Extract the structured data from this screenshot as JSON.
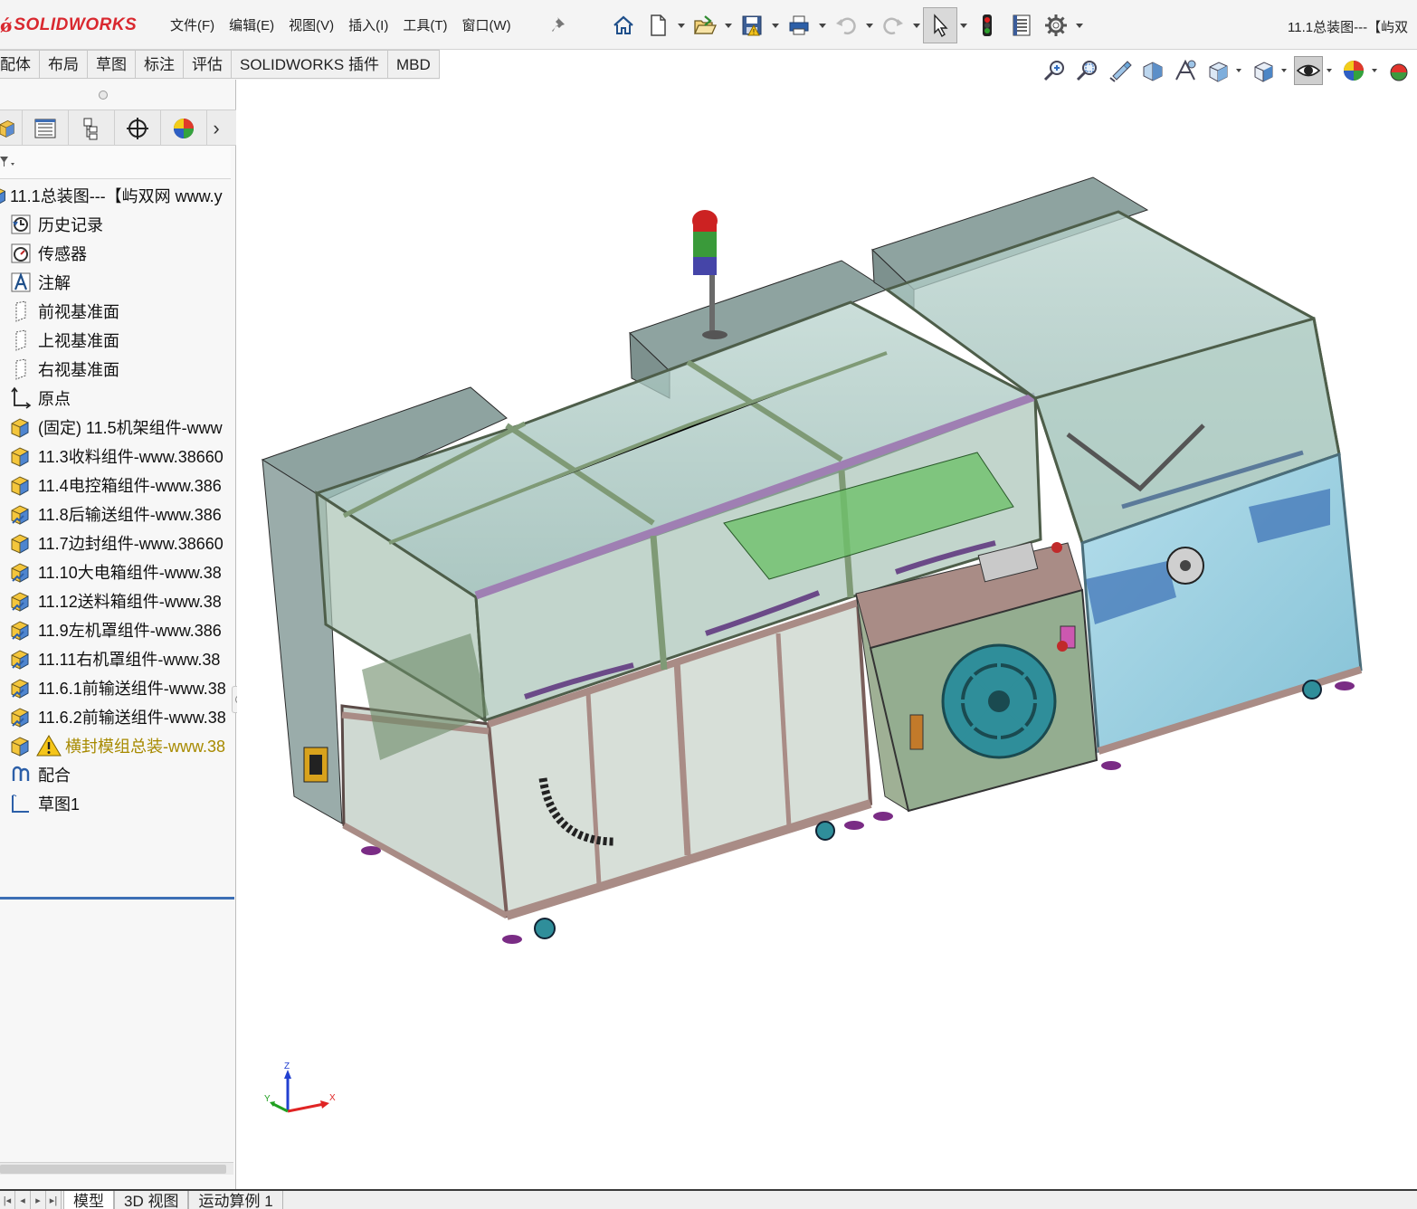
{
  "app": {
    "logo_prefix": "ǿ",
    "logo_text": "SOLIDWORKS"
  },
  "menu": [
    "文件(F)",
    "编辑(E)",
    "视图(V)",
    "插入(I)",
    "工具(T)",
    "窗口(W)"
  ],
  "document_title": "11.1总装图---【屿双",
  "toolbar": [
    {
      "icon": "home-icon"
    },
    {
      "icon": "new-document-icon",
      "dropdown": true
    },
    {
      "icon": "open-icon",
      "dropdown": true
    },
    {
      "icon": "save-icon",
      "dropdown": true
    },
    {
      "icon": "print-icon",
      "dropdown": true
    },
    {
      "icon": "undo-icon",
      "dropdown": true
    },
    {
      "icon": "redo-icon",
      "dropdown": true
    },
    {
      "icon": "select-cursor-icon",
      "dropdown": true,
      "active": true
    },
    {
      "icon": "rebuild-traffic-light-icon"
    },
    {
      "icon": "file-properties-icon"
    },
    {
      "icon": "options-gear-icon",
      "dropdown": true
    }
  ],
  "command_tabs": [
    "配体",
    "布局",
    "草图",
    "标注",
    "评估",
    "SOLIDWORKS 插件",
    "MBD"
  ],
  "hud_icons": [
    "zoom-to-fit-icon",
    "zoom-to-area-icon",
    "previous-view-icon",
    "section-view-icon",
    "dynamic-annotation-icon",
    "view-orientation-icon",
    "display-style-icon",
    "hide-show-items-icon",
    "edit-appearance-icon",
    "apply-scene-icon"
  ],
  "panel_tabs": [
    "featuremanager-tab",
    "propertymanager-tab",
    "configurationmanager-tab",
    "dimxpertmanager-tab",
    "displaymanager-tab"
  ],
  "feature_tree": {
    "root": "11.1总装图---【屿双网 www.y",
    "items": [
      {
        "label": "历史记录",
        "icon": "history-icon"
      },
      {
        "label": "传感器",
        "icon": "sensor-icon"
      },
      {
        "label": "注解",
        "icon": "annotation-icon"
      },
      {
        "label": "前视基准面",
        "icon": "plane-icon"
      },
      {
        "label": "上视基准面",
        "icon": "plane-icon"
      },
      {
        "label": "右视基准面",
        "icon": "plane-icon"
      },
      {
        "label": "原点",
        "icon": "origin-icon"
      },
      {
        "label": "(固定) 11.5机架组件-www",
        "icon": "assembly-icon"
      },
      {
        "label": "11.3收料组件-www.38660",
        "icon": "assembly-icon"
      },
      {
        "label": "11.4电控箱组件-www.386",
        "icon": "assembly-icon"
      },
      {
        "label": "11.8后输送组件-www.386",
        "icon": "assembly-flex-icon"
      },
      {
        "label": "11.7边封组件-www.38660",
        "icon": "assembly-icon"
      },
      {
        "label": "11.10大电箱组件-www.38",
        "icon": "assembly-flex-icon"
      },
      {
        "label": "11.12送料箱组件-www.38",
        "icon": "assembly-flex-icon"
      },
      {
        "label": "11.9左机罩组件-www.386",
        "icon": "assembly-flex-icon"
      },
      {
        "label": "11.11右机罩组件-www.38",
        "icon": "assembly-flex-icon"
      },
      {
        "label": "11.6.1前输送组件-www.38",
        "icon": "assembly-flex-icon"
      },
      {
        "label": "11.6.2前输送组件-www.38",
        "icon": "assembly-flex-icon"
      },
      {
        "label": "横封模组总装-www.38",
        "icon": "assembly-icon",
        "warning": true
      },
      {
        "label": "配合",
        "icon": "mates-icon"
      },
      {
        "label": "草图1",
        "icon": "sketch-icon"
      }
    ]
  },
  "bottom_tabs": [
    "模型",
    "3D 视图",
    "运动算例 1"
  ],
  "triad": {
    "x": "X",
    "y": "Y",
    "z": "Z"
  },
  "colors": {
    "brand_red": "#d9282f",
    "selection_blue": "#3c6fb5",
    "frame_green": "#7f9a76",
    "frame_mauve": "#a98c86",
    "glass_teal": "#5fa2a8",
    "tower_red": "#cc2222",
    "tower_green": "#3a9a3a",
    "tower_blue": "#4545a8"
  }
}
